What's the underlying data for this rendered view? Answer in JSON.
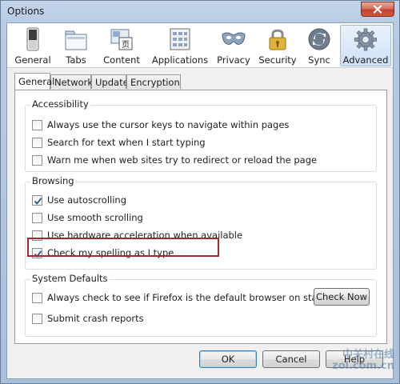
{
  "window": {
    "title": "Options"
  },
  "toolbar": {
    "items": [
      {
        "label": "General",
        "icon": "general-switch-icon"
      },
      {
        "label": "Tabs",
        "icon": "tabs-icon"
      },
      {
        "label": "Content",
        "icon": "content-icon"
      },
      {
        "label": "Applications",
        "icon": "applications-icon"
      },
      {
        "label": "Privacy",
        "icon": "privacy-mask-icon"
      },
      {
        "label": "Security",
        "icon": "security-lock-icon"
      },
      {
        "label": "Sync",
        "icon": "sync-icon"
      },
      {
        "label": "Advanced",
        "icon": "advanced-gear-icon"
      }
    ],
    "selected": "Advanced"
  },
  "tabs": {
    "items": [
      "General",
      "Network",
      "Update",
      "Encryption"
    ],
    "active": "General"
  },
  "accessibility": {
    "title": "Accessibility",
    "options": [
      {
        "label": "Always use the cursor keys to navigate within pages",
        "checked": false
      },
      {
        "label": "Search for text when I start typing",
        "checked": false
      },
      {
        "label": "Warn me when web sites try to redirect or reload the page",
        "checked": false
      }
    ]
  },
  "browsing": {
    "title": "Browsing",
    "options": [
      {
        "label": "Use autoscrolling",
        "checked": true
      },
      {
        "label": "Use smooth scrolling",
        "checked": false
      },
      {
        "label": "Use hardware acceleration when available",
        "checked": false
      },
      {
        "label": "Check my spelling as I type",
        "checked": true
      }
    ]
  },
  "system_defaults": {
    "title": "System Defaults",
    "options": [
      {
        "label": "Always check to see if Firefox is the default browser on startup",
        "checked": false
      },
      {
        "label": "Submit crash reports",
        "checked": false
      }
    ],
    "check_now_label": "Check Now"
  },
  "footer": {
    "ok_label": "OK",
    "cancel_label": "Cancel",
    "help_label": "Help"
  },
  "watermark": {
    "line1": "中关村在线",
    "line2": "zol.com.cn"
  },
  "colors": {
    "highlight_border": "#a3292e",
    "selected_tool_bg": "#cfe1f5",
    "close_button": "#c2402b"
  }
}
